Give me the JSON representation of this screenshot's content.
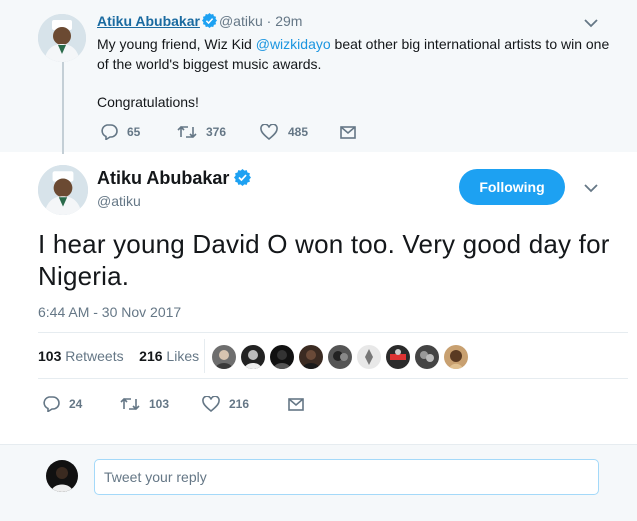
{
  "parent_tweet": {
    "name": "Atiku Abubakar",
    "handle": "@atiku",
    "separator": "·",
    "time": "29m",
    "text_before_mention": "My young friend, Wiz Kid ",
    "mention": "@wizkidayo",
    "text_after_mention": " beat other big international artists to win one of the world's biggest music awards.",
    "text_line2": "Congratulations!",
    "replies": "65",
    "retweets": "376",
    "likes": "485"
  },
  "main_tweet": {
    "name": "Atiku Abubakar",
    "handle": "@atiku",
    "follow_label": "Following",
    "text": "I hear young David O won too. Very good day for Nigeria.",
    "timestamp": "6:44 AM - 30 Nov 2017",
    "retweet_count": "103",
    "retweet_label": "Retweets",
    "like_count": "216",
    "like_label": "Likes",
    "replies": "24",
    "retweets": "103",
    "likes": "216"
  },
  "reply": {
    "placeholder": "Tweet your reply"
  },
  "colors": {
    "accent": "#1da1f2",
    "link": "#1b95e0",
    "muted": "#657786",
    "verified": "#1da1f2"
  },
  "icons": [
    "verified-icon",
    "chevron-down-icon",
    "reply-icon",
    "retweet-icon",
    "heart-icon",
    "message-icon"
  ]
}
